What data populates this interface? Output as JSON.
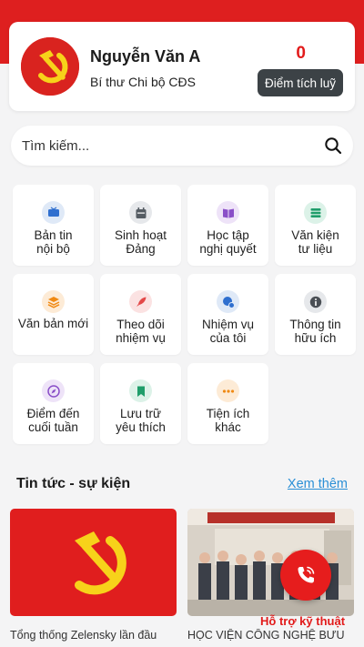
{
  "profile": {
    "name": "Nguyễn Văn A",
    "role": "Bí thư Chi bộ CĐS",
    "points": "0",
    "points_button": "Điểm tích luỹ"
  },
  "search": {
    "placeholder": "Tìm kiếm..."
  },
  "menu": [
    {
      "line1": "Bản tin",
      "line2": "nội bộ",
      "icon": "tv-icon",
      "color": "#2f6fcf"
    },
    {
      "line1": "Sinh hoạt",
      "line2": "Đảng",
      "icon": "calendar-icon",
      "color": "#555c63"
    },
    {
      "line1": "Học tập",
      "line2": "nghị quyết",
      "icon": "book-icon",
      "color": "#8a4fc8"
    },
    {
      "line1": "Văn kiện",
      "line2": "tư liệu",
      "icon": "stack-icon",
      "color": "#1f9d6a"
    },
    {
      "line1": "Văn bản mới",
      "line2": "",
      "icon": "layers-icon",
      "color": "#f08a14"
    },
    {
      "line1": "Theo dõi",
      "line2": "nhiệm vụ",
      "icon": "rocket-icon",
      "color": "#e34848"
    },
    {
      "line1": "Nhiệm vụ",
      "line2": "của tôi",
      "icon": "task-icon",
      "color": "#2f6fcf"
    },
    {
      "line1": "Thông tin",
      "line2": "hữu ích",
      "icon": "info-icon",
      "color": "#4a4f55"
    },
    {
      "line1": "Điểm đến",
      "line2": "cuối tuần",
      "icon": "compass-icon",
      "color": "#8a4fc8"
    },
    {
      "line1": "Lưu trữ",
      "line2": "yêu thích",
      "icon": "bookmark-icon",
      "color": "#1f9d6a"
    },
    {
      "line1": "Tiện ích",
      "line2": "khác",
      "icon": "more-dots-icon",
      "color": "#f08a14"
    }
  ],
  "news": {
    "title": "Tin tức - sự kiện",
    "see_more": "Xem thêm",
    "items": [
      {
        "title": "Tổng thống Zelensky lần đầu"
      },
      {
        "title": "HỌC VIỆN CÔNG NGHỆ BƯU"
      }
    ]
  },
  "support": {
    "label": "Hỗ trợ kỹ thuật"
  },
  "colors": {
    "brand_red": "#de1f1f",
    "emblem_yellow": "#f7d21a",
    "link_blue": "#2a8fd6",
    "button_dark": "#3c4246"
  }
}
